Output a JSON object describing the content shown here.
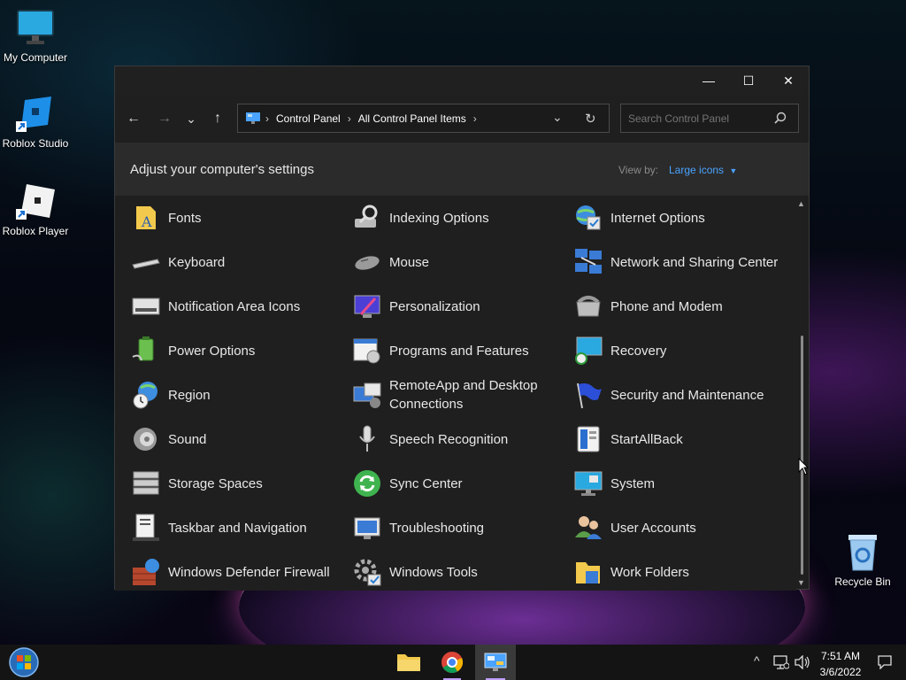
{
  "desktop": {
    "icons": [
      {
        "label": "My Computer",
        "icon": "monitor-icon"
      },
      {
        "label": "Roblox Studio",
        "icon": "roblox-studio-icon"
      },
      {
        "label": "Roblox Player",
        "icon": "roblox-player-icon"
      },
      {
        "label": "Recycle Bin",
        "icon": "recycle-bin-icon"
      }
    ]
  },
  "window": {
    "controls": {
      "minimize": "—",
      "maximize": "☐",
      "close": "✕"
    },
    "nav": {
      "back": "←",
      "forward": "→",
      "recent": "⌄",
      "up": "↑"
    },
    "breadcrumb": [
      "Control Panel",
      "All Control Panel Items"
    ],
    "breadcrumb_sep": "›",
    "address_dropdown": "⌄",
    "refresh": "↻",
    "search": {
      "placeholder": "Search Control Panel",
      "value": ""
    },
    "header": {
      "title": "Adjust your computer's settings",
      "view_by_label": "View by:",
      "view_by_value": "Large icons"
    },
    "items": [
      {
        "label": "Fonts",
        "icon": "fonts-icon"
      },
      {
        "label": "Indexing Options",
        "icon": "indexing-options-icon"
      },
      {
        "label": "Internet Options",
        "icon": "internet-options-icon"
      },
      {
        "label": "Keyboard",
        "icon": "keyboard-icon"
      },
      {
        "label": "Mouse",
        "icon": "mouse-icon"
      },
      {
        "label": "Network and Sharing Center",
        "icon": "network-icon"
      },
      {
        "label": "Notification Area Icons",
        "icon": "notification-area-icon"
      },
      {
        "label": "Personalization",
        "icon": "personalization-icon"
      },
      {
        "label": "Phone and Modem",
        "icon": "phone-modem-icon"
      },
      {
        "label": "Power Options",
        "icon": "power-options-icon"
      },
      {
        "label": "Programs and Features",
        "icon": "programs-features-icon"
      },
      {
        "label": "Recovery",
        "icon": "recovery-icon"
      },
      {
        "label": "Region",
        "icon": "region-icon"
      },
      {
        "label": "RemoteApp and Desktop Connections",
        "icon": "remoteapp-icon"
      },
      {
        "label": "Security and Maintenance",
        "icon": "security-flag-icon"
      },
      {
        "label": "Sound",
        "icon": "sound-icon"
      },
      {
        "label": "Speech Recognition",
        "icon": "microphone-icon"
      },
      {
        "label": "StartAllBack",
        "icon": "startallback-icon"
      },
      {
        "label": "Storage Spaces",
        "icon": "storage-spaces-icon"
      },
      {
        "label": "Sync Center",
        "icon": "sync-center-icon"
      },
      {
        "label": "System",
        "icon": "system-icon"
      },
      {
        "label": "Taskbar and Navigation",
        "icon": "taskbar-navigation-icon"
      },
      {
        "label": "Troubleshooting",
        "icon": "troubleshooting-icon"
      },
      {
        "label": "User Accounts",
        "icon": "user-accounts-icon"
      },
      {
        "label": "Windows Defender Firewall",
        "icon": "firewall-icon"
      },
      {
        "label": "Windows Tools",
        "icon": "windows-tools-icon"
      },
      {
        "label": "Work Folders",
        "icon": "work-folders-icon"
      }
    ],
    "scroll": {
      "up": "▲",
      "down": "▼"
    }
  },
  "taskbar": {
    "apps": [
      {
        "name": "File Explorer",
        "icon": "folder-icon"
      },
      {
        "name": "Google Chrome",
        "icon": "chrome-icon"
      },
      {
        "name": "Control Panel",
        "icon": "control-panel-icon"
      }
    ],
    "tray": {
      "overflow": "^"
    },
    "clock": {
      "time": "7:51 AM",
      "date": "3/6/2022"
    }
  },
  "colors": {
    "accent": "#4aa3ff",
    "window_bg": "#1f1f1f",
    "header_bg": "#2b2b2b",
    "taskbar_bg": "#141414"
  }
}
